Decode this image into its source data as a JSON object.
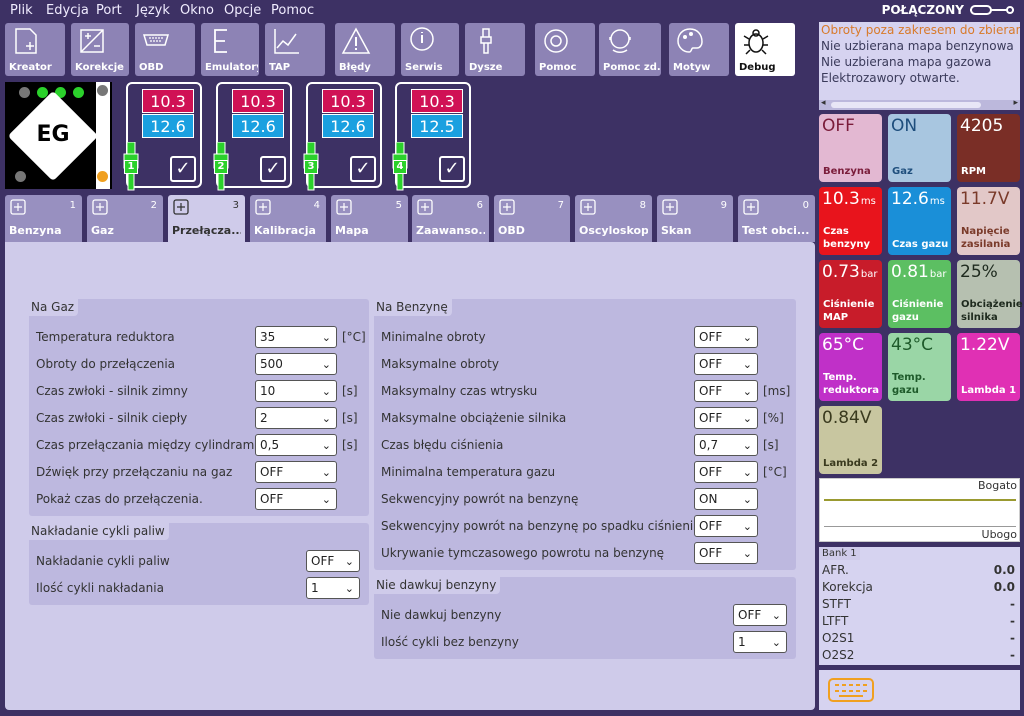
{
  "menu": [
    "Plik",
    "Edycja",
    "Port",
    "Język",
    "Okno",
    "Opcje",
    "Pomoc"
  ],
  "connection_status": "POŁĄCZONY",
  "toolbar": [
    {
      "label": "Kreator",
      "icon": "wizard-icon"
    },
    {
      "label": "Korekcje",
      "icon": "corrections-icon"
    },
    {
      "label": "OBD",
      "icon": "obd-icon"
    },
    {
      "label": "Emulatory",
      "icon": "emulator-icon"
    },
    {
      "label": "TAP",
      "icon": "tap-icon"
    },
    {
      "label": "Błędy",
      "icon": "warning-icon"
    },
    {
      "label": "Serwis",
      "icon": "service-icon"
    },
    {
      "label": "Dysze",
      "icon": "nozzle-icon"
    },
    {
      "label": "Pomoc",
      "icon": "lifebuoy-icon"
    },
    {
      "label": "Pomoc zd...",
      "icon": "remote-help-icon"
    },
    {
      "label": "Motyw",
      "icon": "palette-icon"
    },
    {
      "label": "Debug",
      "icon": "bug-icon"
    }
  ],
  "logo_text": "EG",
  "injectors": [
    {
      "num": "1",
      "petrol": "10.3",
      "gas": "12.6"
    },
    {
      "num": "2",
      "petrol": "10.3",
      "gas": "12.6"
    },
    {
      "num": "3",
      "petrol": "10.3",
      "gas": "12.6"
    },
    {
      "num": "4",
      "petrol": "10.3",
      "gas": "12.5"
    }
  ],
  "tabs": [
    {
      "label": "Benzyna",
      "num": "1"
    },
    {
      "label": "Gaz",
      "num": "2"
    },
    {
      "label": "Przełącza...",
      "num": "3"
    },
    {
      "label": "Kalibracja",
      "num": "4"
    },
    {
      "label": "Mapa",
      "num": "5"
    },
    {
      "label": "Zaawanso...",
      "num": "6"
    },
    {
      "label": "OBD",
      "num": "7"
    },
    {
      "label": "Oscyloskop",
      "num": "8"
    },
    {
      "label": "Skan",
      "num": "9"
    },
    {
      "label": "Test obci...",
      "num": "0"
    }
  ],
  "na_gaz": {
    "title": "Na Gaz",
    "rows": [
      {
        "label": "Temperatura reduktora",
        "value": "35",
        "unit": "[°C]"
      },
      {
        "label": "Obroty do przełączenia",
        "value": "500",
        "unit": ""
      },
      {
        "label": "Czas zwłoki - silnik zimny",
        "value": "10",
        "unit": "[s]"
      },
      {
        "label": "Czas zwłoki - silnik ciepły",
        "value": "2",
        "unit": "[s]"
      },
      {
        "label": "Czas przełączania między cylindrami",
        "value": "0,5",
        "unit": "[s]"
      },
      {
        "label": "Dźwięk przy przełączaniu na gaz",
        "value": "OFF",
        "unit": ""
      },
      {
        "label": "Pokaż czas do przełączenia.",
        "value": "OFF",
        "unit": ""
      }
    ]
  },
  "nakladanie": {
    "title": "Nakładanie cykli paliw",
    "rows": [
      {
        "label": "Nakładanie cykli paliw",
        "value": "OFF"
      },
      {
        "label": "Ilość cykli nakładania",
        "value": "1"
      }
    ]
  },
  "na_benzyne": {
    "title": "Na Benzynę",
    "rows": [
      {
        "label": "Minimalne obroty",
        "value": "OFF",
        "unit": ""
      },
      {
        "label": "Maksymalne obroty",
        "value": "OFF",
        "unit": ""
      },
      {
        "label": "Maksymalny czas wtrysku",
        "value": "OFF",
        "unit": "[ms]"
      },
      {
        "label": "Maksymalne obciążenie silnika",
        "value": "OFF",
        "unit": "[%]"
      },
      {
        "label": "Czas błędu ciśnienia",
        "value": "0,7",
        "unit": "[s]"
      },
      {
        "label": "Minimalna temperatura gazu",
        "value": "OFF",
        "unit": "[°C]"
      },
      {
        "label": "Sekwencyjny powrót na benzynę",
        "value": "ON",
        "unit": ""
      },
      {
        "label": "Sekwencyjny powrót na benzynę po spadku ciśnienia",
        "value": "OFF",
        "unit": ""
      },
      {
        "label": "Ukrywanie tymczasowego powrotu na benzynę",
        "value": "OFF",
        "unit": ""
      }
    ]
  },
  "nie_dawkuj": {
    "title": "Nie dawkuj benzyny",
    "rows": [
      {
        "label": "Nie dawkuj benzyny",
        "value": "OFF"
      },
      {
        "label": "Ilość cykli bez benzyny",
        "value": "1"
      }
    ]
  },
  "messages": [
    {
      "text": "Obroty poza zakresem do zbierania",
      "warn": true
    },
    {
      "text": "Nie uzbierana mapa benzynowa",
      "warn": false
    },
    {
      "text": "Nie uzbierana mapa gazowa",
      "warn": false
    },
    {
      "text": "Elektrozawory otwarte.",
      "warn": false
    }
  ],
  "tiles": [
    {
      "value": "OFF",
      "unit": "",
      "label": "Benzyna",
      "bg": "#e3b8d2",
      "fg": "#7a1c3a"
    },
    {
      "value": "ON",
      "unit": "",
      "label": "Gaz",
      "bg": "#a8c6e0",
      "fg": "#1e4e7c"
    },
    {
      "value": "4205",
      "unit": "",
      "label": "RPM",
      "bg": "#7a2e26",
      "fg": "#ffffff"
    },
    {
      "value": "10.3",
      "unit": "ms",
      "label": "Czas benzyny",
      "bg": "#e8141c",
      "fg": "#ffffff"
    },
    {
      "value": "12.6",
      "unit": "ms",
      "label": "Czas gazu",
      "bg": "#1a8fd8",
      "fg": "#ffffff"
    },
    {
      "value": "11.7",
      "unit": "V",
      "label": "Napięcie zasilania",
      "bg": "#e2c8c8",
      "fg": "#7a3a2a"
    },
    {
      "value": "0.73",
      "unit": "bar",
      "label": "Ciśnienie MAP",
      "bg": "#c81c2a",
      "fg": "#ffffff"
    },
    {
      "value": "0.81",
      "unit": "bar",
      "label": "Ciśnienie gazu",
      "bg": "#5cbf62",
      "fg": "#ffffff"
    },
    {
      "value": "25",
      "unit": "%",
      "label": "Obciążenie silnika",
      "bg": "#b6c0b0",
      "fg": "#1e2a1e"
    },
    {
      "value": "65",
      "unit": "°C",
      "label": "Temp. reduktora",
      "bg": "#c030c8",
      "fg": "#ffffff"
    },
    {
      "value": "43",
      "unit": "°C",
      "label": "Temp. gazu",
      "bg": "#9ad6a6",
      "fg": "#1e5a2a"
    },
    {
      "value": "1.22",
      "unit": "V",
      "label": "Lambda 1",
      "bg": "#e030b4",
      "fg": "#ffffff"
    },
    {
      "value": "0.84",
      "unit": "V",
      "label": "Lambda 2",
      "bg": "#c8c6a0",
      "fg": "#3a3a1e"
    }
  ],
  "graph": {
    "top_label": "Bogato",
    "bottom_label": "Ubogo"
  },
  "bank": {
    "title": "Bank 1",
    "rows": [
      {
        "label": "AFR.",
        "value": "0.0"
      },
      {
        "label": "Korekcja",
        "value": "0.0"
      },
      {
        "label": "STFT",
        "value": "-"
      },
      {
        "label": "LTFT",
        "value": "-"
      },
      {
        "label": "O2S1",
        "value": "-"
      },
      {
        "label": "O2S2",
        "value": "-"
      }
    ]
  },
  "colors": {
    "accent": "#3d3164",
    "panel": "#cfcbea",
    "toolbar": "#8d83b5",
    "petrol": "#d01155",
    "gas": "#1aa0e0",
    "nozzle": "#2bd12b"
  }
}
